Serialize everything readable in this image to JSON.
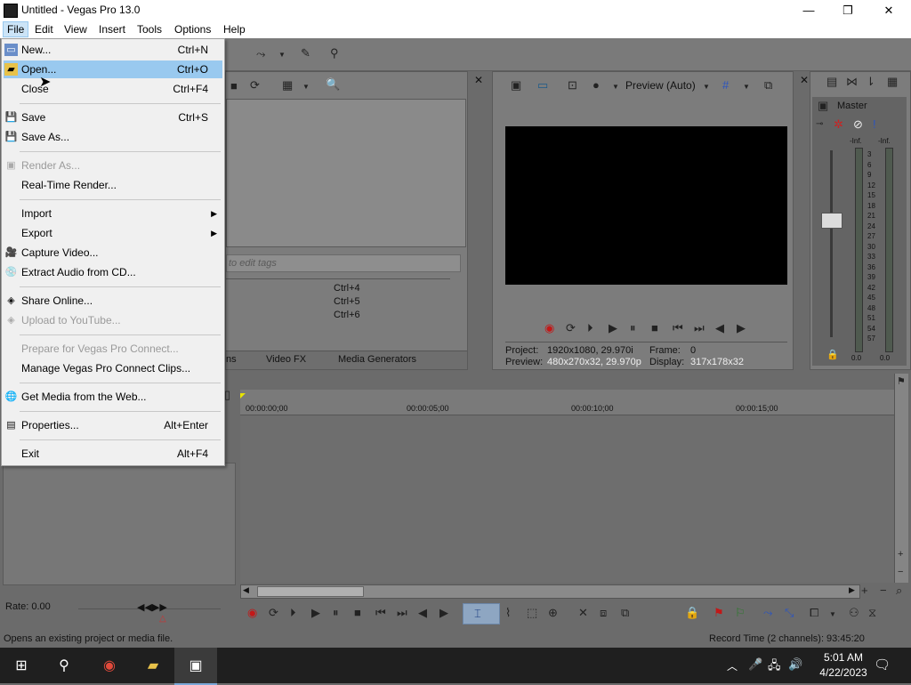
{
  "window": {
    "title": "Untitled - Vegas Pro 13.0",
    "minimize": "—",
    "maximize": "❐",
    "close": "✕"
  },
  "menubar": [
    "File",
    "Edit",
    "View",
    "Insert",
    "Tools",
    "Options",
    "Help"
  ],
  "file_menu": {
    "new": {
      "label": "New...",
      "shortcut": "Ctrl+N"
    },
    "open": {
      "label": "Open...",
      "shortcut": "Ctrl+O"
    },
    "close": {
      "label": "Close",
      "shortcut": "Ctrl+F4"
    },
    "save": {
      "label": "Save",
      "shortcut": "Ctrl+S"
    },
    "save_as": {
      "label": "Save As..."
    },
    "render_as": {
      "label": "Render As..."
    },
    "realtime_render": {
      "label": "Real-Time Render..."
    },
    "import": {
      "label": "Import"
    },
    "export": {
      "label": "Export"
    },
    "capture_video": {
      "label": "Capture Video..."
    },
    "extract_audio": {
      "label": "Extract Audio from CD..."
    },
    "share_online": {
      "label": "Share Online..."
    },
    "upload_youtube": {
      "label": "Upload to YouTube..."
    },
    "prepare_connect": {
      "label": "Prepare for Vegas Pro Connect..."
    },
    "manage_connect": {
      "label": "Manage Vegas Pro Connect Clips..."
    },
    "get_media": {
      "label": "Get Media from the Web..."
    },
    "properties": {
      "label": "Properties...",
      "shortcut": "Alt+Enter"
    },
    "exit": {
      "label": "Exit",
      "shortcut": "Alt+F4"
    }
  },
  "explorer": {
    "tags_placeholder": "to edit tags",
    "shortcuts": [
      "Ctrl+4",
      "Ctrl+5",
      "Ctrl+6"
    ],
    "tabs": [
      "ns",
      "Video FX",
      "Media Generators"
    ]
  },
  "preview": {
    "mode": "Preview (Auto)",
    "project_label": "Project:",
    "project_value": "1920x1080, 29.970i",
    "frame_label": "Frame:",
    "frame_value": "0",
    "preview_label": "Preview:",
    "preview_value": "480x270x32, 29.970p",
    "display_label": "Display:",
    "display_value": "317x178x32"
  },
  "master": {
    "label": "Master",
    "inf_left": "-Inf.",
    "inf_right": "-Inf.",
    "scale": [
      "3",
      "6",
      "9",
      "12",
      "15",
      "18",
      "21",
      "24",
      "27",
      "30",
      "33",
      "36",
      "39",
      "42",
      "45",
      "48",
      "51",
      "54",
      "57"
    ],
    "val_left": "0.0",
    "val_right": "0.0"
  },
  "timeline": {
    "ticks": [
      "00:00:00;00",
      "00:00:05;00",
      "00:00:10;00",
      "00:00:15;00"
    ],
    "rate": "Rate: 0.00"
  },
  "status": {
    "message": "Opens an existing project or media file.",
    "record_time": "Record Time (2 channels): 93:45:20"
  },
  "taskbar": {
    "time": "5:01 AM",
    "date": "4/22/2023"
  },
  "colors": {
    "menu_highlight": "#99c9ef",
    "panel": "#7c7c7c",
    "taskbar": "#1f1f1f"
  }
}
